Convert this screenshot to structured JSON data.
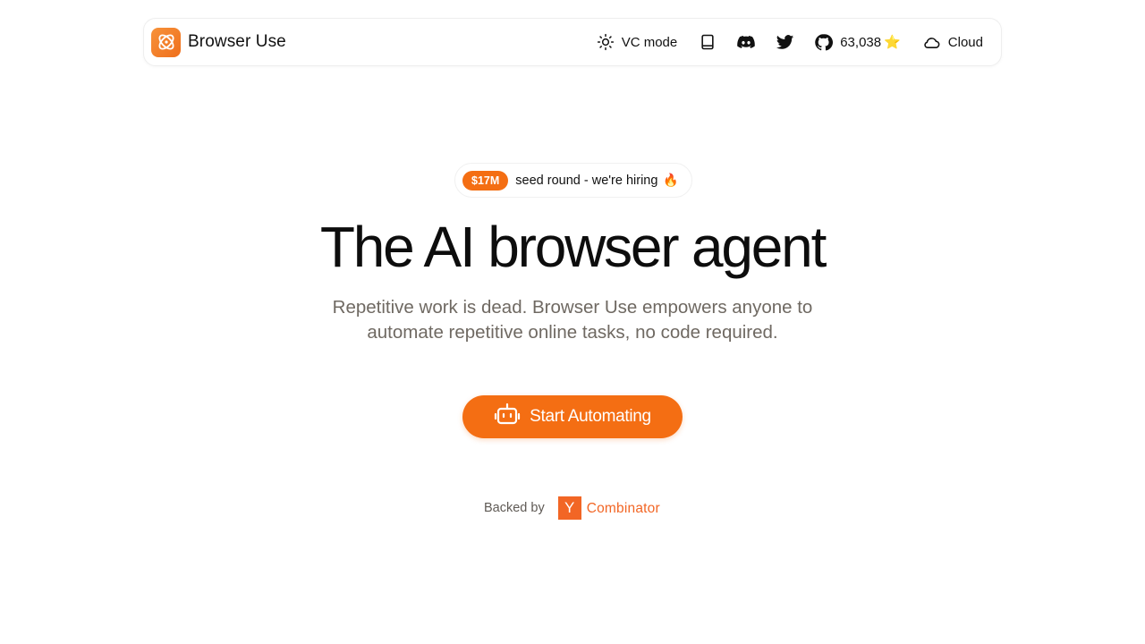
{
  "header": {
    "brand_name": "Browser Use",
    "vc_mode_label": "VC mode",
    "github_stars": "63,038",
    "github_star_emoji": "⭐",
    "cloud_label": "Cloud",
    "icons": [
      "sun-icon",
      "book-icon",
      "discord-icon",
      "twitter-icon",
      "github-icon",
      "cloud-icon"
    ]
  },
  "announcement": {
    "badge": "$17M",
    "text": "seed round - we're hiring",
    "emoji": "🔥"
  },
  "hero": {
    "title": "The AI browser agent",
    "subtitle": "Repetitive work is dead. Browser Use empowers anyone to automate repetitive online tasks, no code required."
  },
  "cta": {
    "label": "Start Automating",
    "icon": "robot-icon"
  },
  "backed": {
    "label": "Backed by",
    "yc_letter": "Y",
    "yc_word": "Combinator"
  },
  "colors": {
    "accent": "#f46e13",
    "yc_orange": "#f26625",
    "subtitle_gray": "#6f6962",
    "text": "#111111"
  }
}
